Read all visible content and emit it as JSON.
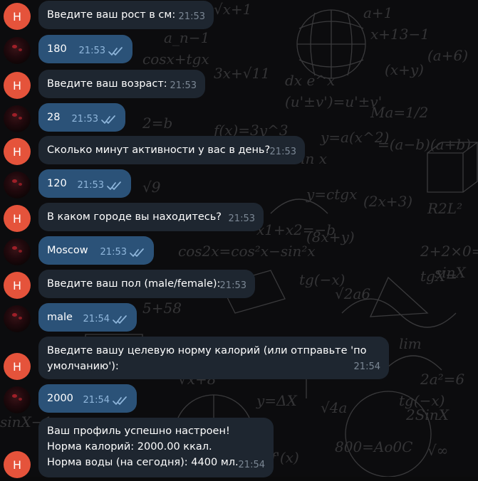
{
  "bot_avatar_letter": "H",
  "messages": [
    {
      "sender": "bot",
      "text": "Введите ваш рост в см:",
      "time": "21:53"
    },
    {
      "sender": "user",
      "text": "180",
      "time": "21:53",
      "read": true
    },
    {
      "sender": "bot",
      "text": "Введите ваш возраст:",
      "time": "21:53"
    },
    {
      "sender": "user",
      "text": "28",
      "time": "21:53",
      "read": true
    },
    {
      "sender": "bot",
      "text": "Сколько минут активности у вас в день?",
      "time": "21:53"
    },
    {
      "sender": "user",
      "text": "120",
      "time": "21:53",
      "read": true
    },
    {
      "sender": "bot",
      "text": "В каком городе вы находитесь?",
      "time": "21:53"
    },
    {
      "sender": "user",
      "text": "Moscow",
      "time": "21:53",
      "read": true
    },
    {
      "sender": "bot",
      "text": "Введите ваш пол (male/female):",
      "time": "21:53"
    },
    {
      "sender": "user",
      "text": "male",
      "time": "21:54",
      "read": true
    },
    {
      "sender": "bot",
      "text": "Введите вашу целевую норму калорий (или отправьте 'по умолчанию'):",
      "time": "21:54"
    },
    {
      "sender": "user",
      "text": "2000",
      "time": "21:54",
      "read": true
    },
    {
      "sender": "bot",
      "text": "Ваш профиль успешно настроен!\nНорма калорий: 2000.00 ккал.\nНорма воды (на сегодня): 4400 мл.",
      "time": "21:54"
    }
  ],
  "colors": {
    "incoming_bubble": "#1e2630",
    "outgoing_bubble": "#2b5278",
    "bot_avatar": "#e5533b",
    "read_checks": "#8fb6db"
  },
  "icons": {
    "read_receipt": "double-check-icon"
  }
}
